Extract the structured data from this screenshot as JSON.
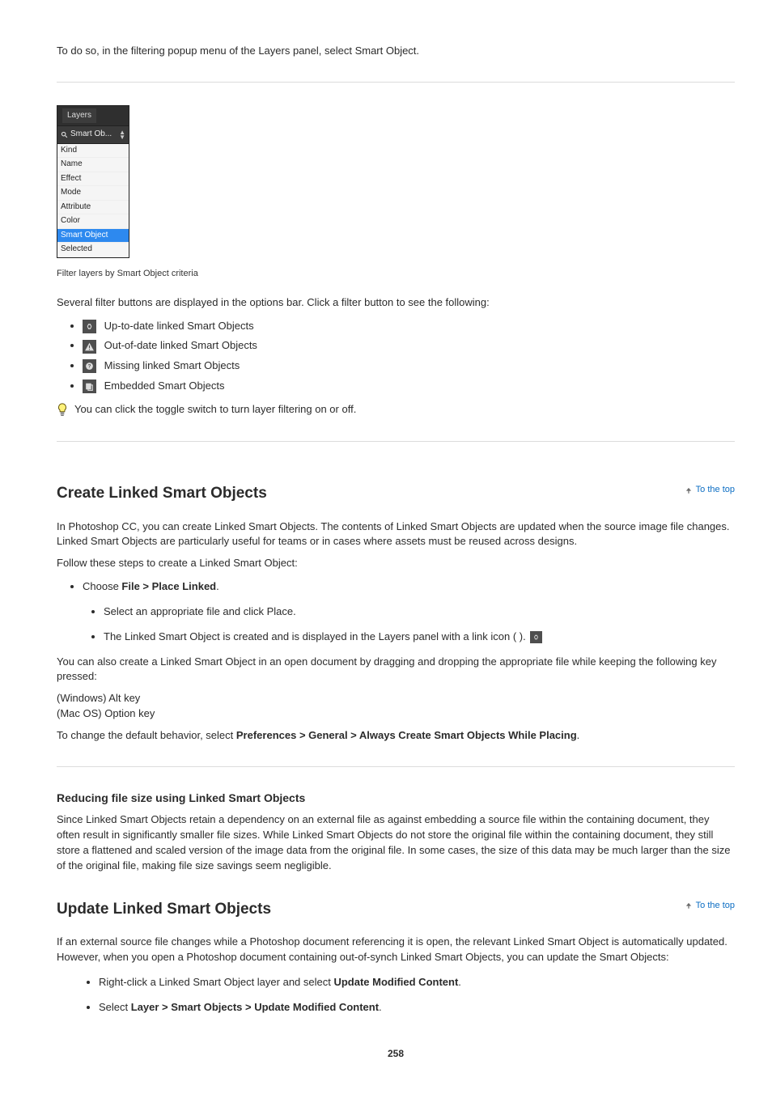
{
  "intro_line": "To do so, in the filtering popup menu of the Layers panel, select Smart Object.",
  "layers_panel": {
    "title": "Layers",
    "filter_text": "Smart Ob...",
    "items": [
      "Kind",
      "Name",
      "Effect",
      "Mode",
      "Attribute",
      "Color",
      "Smart Object",
      "Selected"
    ]
  },
  "caption": "Filter layers by Smart Object criteria",
  "filter_intro": "Several filter buttons are displayed in the options bar. Click a filter button to see the following:",
  "filters": [
    {
      "label": "Up-to-date linked Smart Objects"
    },
    {
      "label": "Out-of-date linked Smart Objects"
    },
    {
      "label": "Missing linked Smart Objects"
    },
    {
      "label": "Embedded Smart Objects"
    }
  ],
  "tip_text": "You can click the toggle switch to turn layer filtering on or off.",
  "sec2": {
    "heading": "Create Linked Smart Objects",
    "p1": "In Photoshop CC, you can create Linked Smart Objects. The contents of Linked Smart Objects are updated when the source image file changes. Linked Smart Objects are particularly useful for teams or in cases where assets must be reused across designs.",
    "p2_lead": "Follow these steps to create a Linked Smart Object:",
    "steps": [
      {
        "line1_prefix": "Choose ",
        "line1_path": "File > Place Linked",
        "line1_suffix": ".",
        "sub": [
          {
            "text": "Select an appropriate file and click Place."
          },
          {
            "text": "The Linked Smart Object is created and is displayed in the Layers panel with a link icon ( )."
          }
        ]
      }
    ],
    "p3": "You can also create a Linked Smart Object in an open document by dragging and dropping the appropriate file while keeping the following key pressed:",
    "p4": "(Windows) Alt key\n(Mac OS) Option key",
    "p5_prefix": "To change the default behavior, select ",
    "p5_path": "Preferences > General > Always Create Smart Objects While Placing",
    "p5_suffix": "."
  },
  "sec3": {
    "heading1": "Reducing file size using Linked Smart Objects",
    "p1": "Since Linked Smart Objects retain a dependency on an external file as against embedding a source file within the containing document, they often result in significantly smaller file sizes. While Linked Smart Objects do not store the original file within the containing document, they still store a flattened and scaled version of the image data from the original file. In some cases, the size of this data may be much larger than the size of the original file, making file size savings seem negligible.",
    "heading2": "Update Linked Smart Objects",
    "p2": "If an external source file changes while a Photoshop document referencing it is open, the relevant Linked Smart Object is automatically updated. However, when you open a Photoshop document containing out-of-synch Linked Smart Objects, you can update the Smart Objects:",
    "bullets": [
      {
        "prefix": "Right-click a Linked Smart Object layer and select ",
        "bold": "Update Modified Content",
        "suffix": "."
      },
      {
        "prefix": "Select ",
        "bold": "Layer > Smart Objects > Update Modified Content",
        "suffix": "."
      }
    ]
  },
  "links": {
    "top": "To the top"
  },
  "page_number": "258"
}
